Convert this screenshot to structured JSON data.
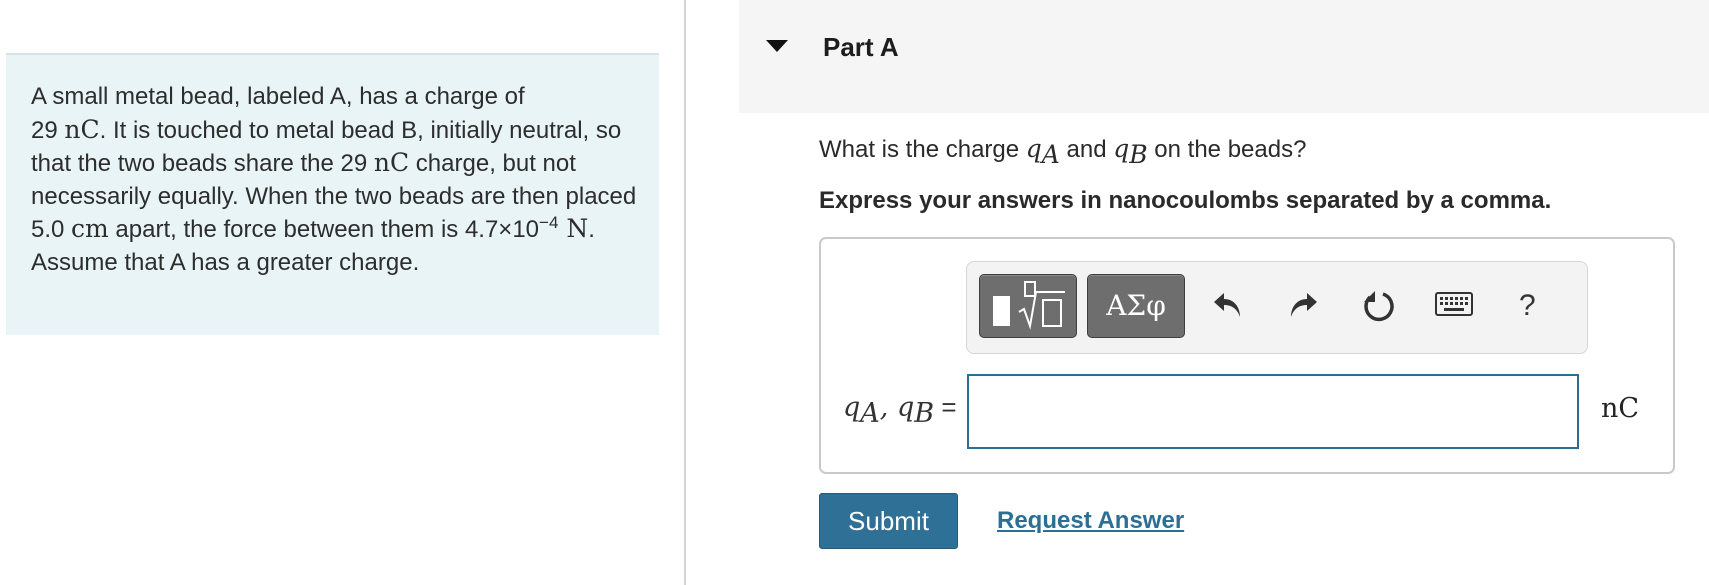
{
  "problem": {
    "s1": "A small metal bead, labeled A, has a charge of",
    "s2": "29 ",
    "u1": "nC",
    "s3": ". It is touched to metal bead B, initially neutral, so that the two beads share the 29 ",
    "u2": "nC",
    "s4": " charge, but not necessarily equally. When the two beads are then placed 5.0 ",
    "u3": "cm",
    "s5": " apart, the force between them is 4.7×10",
    "exp": "−4",
    "u4": " N",
    "s6": ". Assume that A has a greater charge."
  },
  "part": {
    "title": "Part A"
  },
  "question": {
    "t1": "What is the charge ",
    "q": "q",
    "sub_a": "A",
    "t2": " and ",
    "sub_b": "B",
    "t3": " on the beads?"
  },
  "instruction": "Express your answers in nanocoulombs separated by a comma.",
  "toolbar": {
    "symbols_label": "ΑΣφ",
    "help_label": "?",
    "icons": [
      "templates-icon",
      "undo-icon",
      "redo-icon",
      "reset-icon",
      "keyboard-icon"
    ]
  },
  "answer": {
    "q": "q",
    "sub_a": "A",
    "sep": ", ",
    "sub_b": "B",
    "eq": " =",
    "value": "",
    "placeholder": "",
    "unit": "nC"
  },
  "actions": {
    "submit_label": "Submit",
    "request_label": "Request Answer"
  },
  "colors": {
    "accent": "#2f7097",
    "link": "#2c6f94",
    "problem_bg": "#e8f4f6"
  }
}
